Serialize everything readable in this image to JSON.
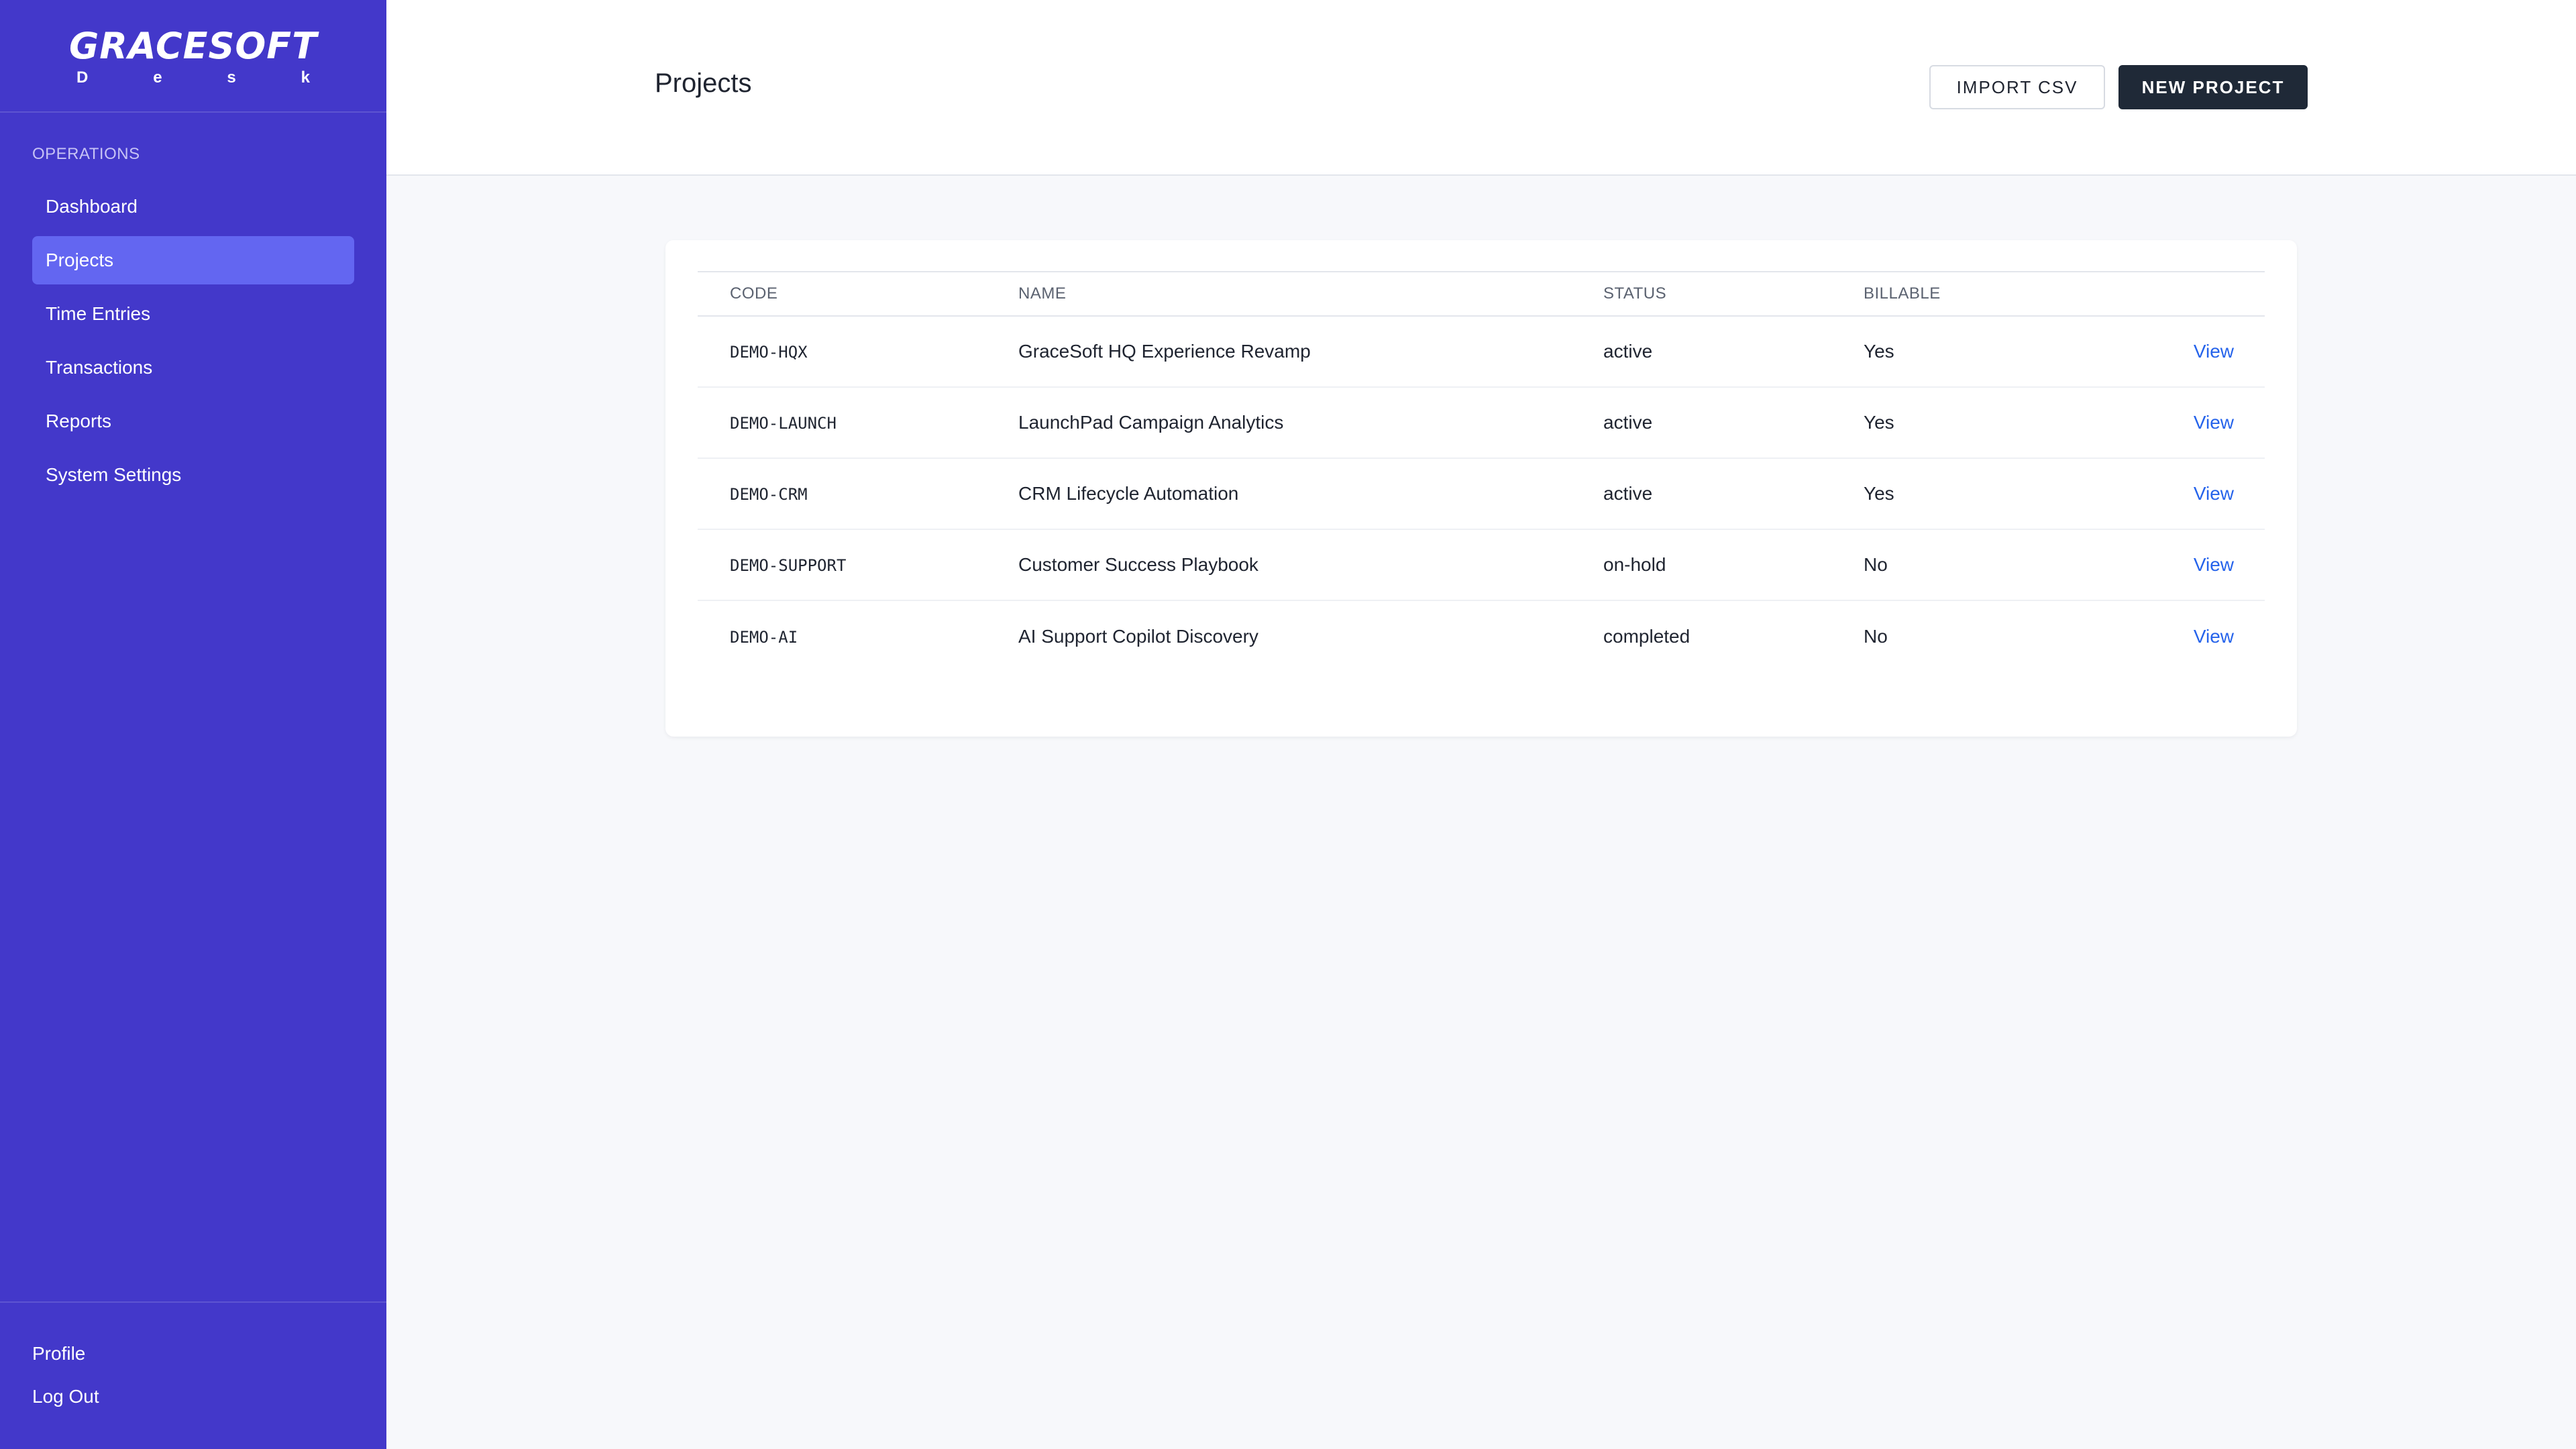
{
  "brand": {
    "name": "GRACESOFT",
    "sub_letters": [
      "D",
      "e",
      "s",
      "k"
    ]
  },
  "sidebar": {
    "section_heading": "OPERATIONS",
    "items": [
      {
        "label": "Dashboard",
        "active": false
      },
      {
        "label": "Projects",
        "active": true
      },
      {
        "label": "Time Entries",
        "active": false
      },
      {
        "label": "Transactions",
        "active": false
      },
      {
        "label": "Reports",
        "active": false
      },
      {
        "label": "System Settings",
        "active": false
      }
    ],
    "bottom": {
      "profile_label": "Profile",
      "logout_label": "Log Out"
    }
  },
  "header": {
    "title": "Projects",
    "import_label": "IMPORT CSV",
    "new_label": "NEW PROJECT"
  },
  "table": {
    "columns": [
      "CODE",
      "NAME",
      "STATUS",
      "BILLABLE",
      ""
    ],
    "rows": [
      {
        "code": "DEMO-HQX",
        "name": "GraceSoft HQ Experience Revamp",
        "status": "active",
        "billable": "Yes",
        "action": "View"
      },
      {
        "code": "DEMO-LAUNCH",
        "name": "LaunchPad Campaign Analytics",
        "status": "active",
        "billable": "Yes",
        "action": "View"
      },
      {
        "code": "DEMO-CRM",
        "name": "CRM Lifecycle Automation",
        "status": "active",
        "billable": "Yes",
        "action": "View"
      },
      {
        "code": "DEMO-SUPPORT",
        "name": "Customer Success Playbook",
        "status": "on-hold",
        "billable": "No",
        "action": "View"
      },
      {
        "code": "DEMO-AI",
        "name": "AI Support Copilot Discovery",
        "status": "completed",
        "billable": "No",
        "action": "View"
      }
    ]
  },
  "colors": {
    "sidebar_bg": "#4338ca",
    "active_item_bg": "#6366f1",
    "primary_button_bg": "#1f2937",
    "link": "#2563eb",
    "page_bg": "#f7f8fb"
  }
}
